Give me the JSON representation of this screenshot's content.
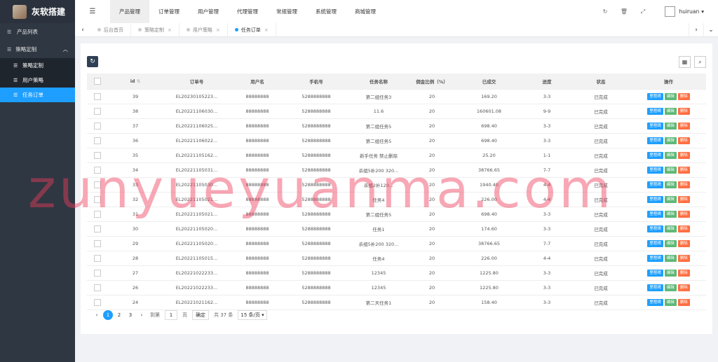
{
  "brand": {
    "title": "灰软搭建"
  },
  "sidebar": {
    "items": [
      {
        "label": "产品列表",
        "icon": "list-icon"
      },
      {
        "label": "策略定制",
        "icon": "list-icon"
      }
    ],
    "submenu": [
      {
        "label": "策略定制",
        "icon": "list-icon"
      },
      {
        "label": "用户策略",
        "icon": "list-icon"
      },
      {
        "label": "任务订单",
        "icon": "list-icon",
        "active": true
      }
    ]
  },
  "topnav": [
    "产品管理",
    "订单管理",
    "用户管理",
    "代理管理",
    "常规管理",
    "系统管理",
    "商城管理"
  ],
  "user": {
    "name": "huiruan"
  },
  "tabs": [
    {
      "label": "后台首页",
      "closable": false
    },
    {
      "label": "策略定制",
      "closable": true
    },
    {
      "label": "用户策略",
      "closable": true
    },
    {
      "label": "任务订单",
      "closable": true,
      "active": true
    }
  ],
  "table": {
    "headers": [
      "",
      "id",
      "订单号",
      "用户名",
      "手机号",
      "任务名称",
      "佣金比例（%）",
      "已成交",
      "进度",
      "状态",
      "操作"
    ],
    "rows": [
      [
        "39",
        "EL20230105223...",
        "88888888",
        "5288888888",
        "第二组任务3",
        "20",
        "169.20",
        "3-3",
        "已完成"
      ],
      [
        "38",
        "EL20221106030...",
        "88888888",
        "5288888888",
        "11.6",
        "20",
        "160601.08",
        "9-9",
        "已完成"
      ],
      [
        "37",
        "EL20221106025...",
        "88888888",
        "5288888888",
        "第二组任务5",
        "20",
        "698.40",
        "3-3",
        "已完成"
      ],
      [
        "36",
        "EL20221106022...",
        "88888888",
        "5288888888",
        "第二组任务5",
        "20",
        "698.40",
        "3-3",
        "已完成"
      ],
      [
        "35",
        "EL20221105162...",
        "88888888",
        "5288888888",
        "新手任务 禁止删除",
        "20",
        "25.20",
        "1-1",
        "已完成"
      ],
      [
        "34",
        "EL20221105031...",
        "88888888",
        "5288888888",
        "杀组5补200 320...",
        "20",
        "38766.65",
        "7-7",
        "已完成"
      ],
      [
        "33",
        "EL20221105030...",
        "88888888",
        "5288888888",
        "杀组2补120...",
        "20",
        "1940.40",
        "4-4",
        "已完成"
      ],
      [
        "32",
        "EL20221105021...",
        "88888888",
        "5288888888",
        "任务4",
        "20",
        "226.00",
        "4-4",
        "已完成"
      ],
      [
        "31",
        "EL20221105021...",
        "88888888",
        "5288888888",
        "第二组任务5",
        "20",
        "698.40",
        "3-3",
        "已完成"
      ],
      [
        "30",
        "EL20221105020...",
        "88888888",
        "5288888888",
        "任务1",
        "20",
        "174.60",
        "3-3",
        "已完成"
      ],
      [
        "29",
        "EL20221105020...",
        "88888888",
        "5288888888",
        "杀组5补200 320...",
        "20",
        "38766.65",
        "7-7",
        "已完成"
      ],
      [
        "28",
        "EL20221105015...",
        "88888888",
        "5288888888",
        "任务4",
        "20",
        "226.00",
        "4-4",
        "已完成"
      ],
      [
        "27",
        "EL20221022233...",
        "88888888",
        "5288888888",
        "12345",
        "20",
        "1225.80",
        "3-3",
        "已完成"
      ],
      [
        "26",
        "EL20221022233...",
        "88888888",
        "5288888888",
        "12345",
        "20",
        "1225.80",
        "3-3",
        "已完成"
      ],
      [
        "24",
        "EL20221021162...",
        "88888888",
        "5288888888",
        "第二天任务1",
        "20",
        "158.40",
        "3-3",
        "已完成"
      ]
    ],
    "ops": {
      "detail": "里程碑",
      "edit": "编辑",
      "del": "删除"
    }
  },
  "pager": {
    "pages": [
      "1",
      "2",
      "3"
    ],
    "goto_label": "到第",
    "goto_value": "1",
    "page_unit": "页",
    "confirm": "确定",
    "total": "共 37 条",
    "page_size": "15 条/页"
  },
  "watermark": "zunyueyuanma.com"
}
